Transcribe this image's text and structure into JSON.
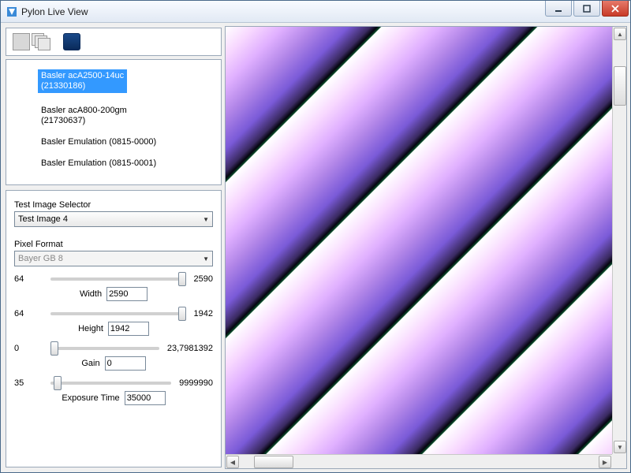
{
  "window": {
    "title": "Pylon Live View"
  },
  "cameras": [
    {
      "name": "Basler acA2500-14uc",
      "serial": "(21330186)",
      "selected": true
    },
    {
      "name": "Basler acA800-200gm",
      "serial": "(21730637)",
      "selected": false
    },
    {
      "name": "Basler Emulation (0815-0000)",
      "serial": "",
      "selected": false
    },
    {
      "name": "Basler Emulation (0815-0001)",
      "serial": "",
      "selected": false
    }
  ],
  "controls": {
    "test_image_selector_label": "Test Image Selector",
    "test_image_selector_value": "Test Image 4",
    "pixel_format_label": "Pixel Format",
    "pixel_format_value": "Bayer GB 8",
    "width": {
      "label": "Width",
      "min": "64",
      "max": "2590",
      "value": "2590",
      "pos": 100
    },
    "height": {
      "label": "Height",
      "min": "64",
      "max": "1942",
      "value": "1942",
      "pos": 100
    },
    "gain": {
      "label": "Gain",
      "min": "0",
      "max": "23,7981392",
      "value": "0",
      "pos": 0
    },
    "exposure": {
      "label": "Exposure Time",
      "min": "35",
      "max": "9999990",
      "value": "35000",
      "pos": 2
    }
  }
}
